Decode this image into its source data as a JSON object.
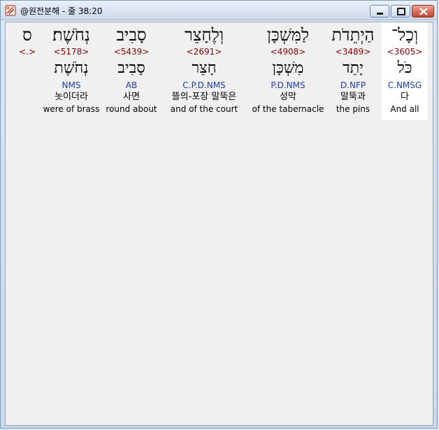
{
  "window": {
    "title": "@원전분해 - 줄 38:20",
    "buttons": {
      "minimize": "minimize",
      "maximize": "maximize",
      "close": "close"
    }
  },
  "columns": [
    {
      "heb": "וְכָל־",
      "strong": "<3605>",
      "lemma": "כֹּל",
      "morph": "C.NMSG",
      "kor": "다",
      "eng": "And all",
      "selected": true
    },
    {
      "heb": "הַיְתֵדֹת",
      "strong": "<3489>",
      "lemma": "יָתֵד",
      "morph": "D.NFP",
      "kor": "말뚝과",
      "eng": "the pins",
      "selected": false
    },
    {
      "heb": "לַמִּשְׁכָּן",
      "strong": "<4908>",
      "lemma": "מִשְׁכָּן",
      "morph": "P.D.NMS",
      "kor": "성막",
      "eng": "of the tabernacle",
      "selected": false
    },
    {
      "heb": "וְלֶחָצֵר",
      "strong": "<2691>",
      "lemma": "חָצֵר",
      "morph": "C.P.D.NMS",
      "kor": "뜰의-포장 말뚝은",
      "eng": "and of the court",
      "selected": false
    },
    {
      "heb": "סָבִיב",
      "strong": "<5439>",
      "lemma": "סָבִיב",
      "morph": "AB",
      "kor": "사면",
      "eng": "round about",
      "selected": false
    },
    {
      "heb": "נְחֹשֶׁת׃",
      "strong": "<5178>",
      "lemma": "נְחֹשֶׁת",
      "morph": "NMS",
      "kor": "놋이더라",
      "eng": "were of brass",
      "selected": false
    },
    {
      "heb": "ס",
      "strong": "<.>",
      "lemma": "",
      "morph": "",
      "kor": "",
      "eng": "",
      "selected": false
    }
  ]
}
